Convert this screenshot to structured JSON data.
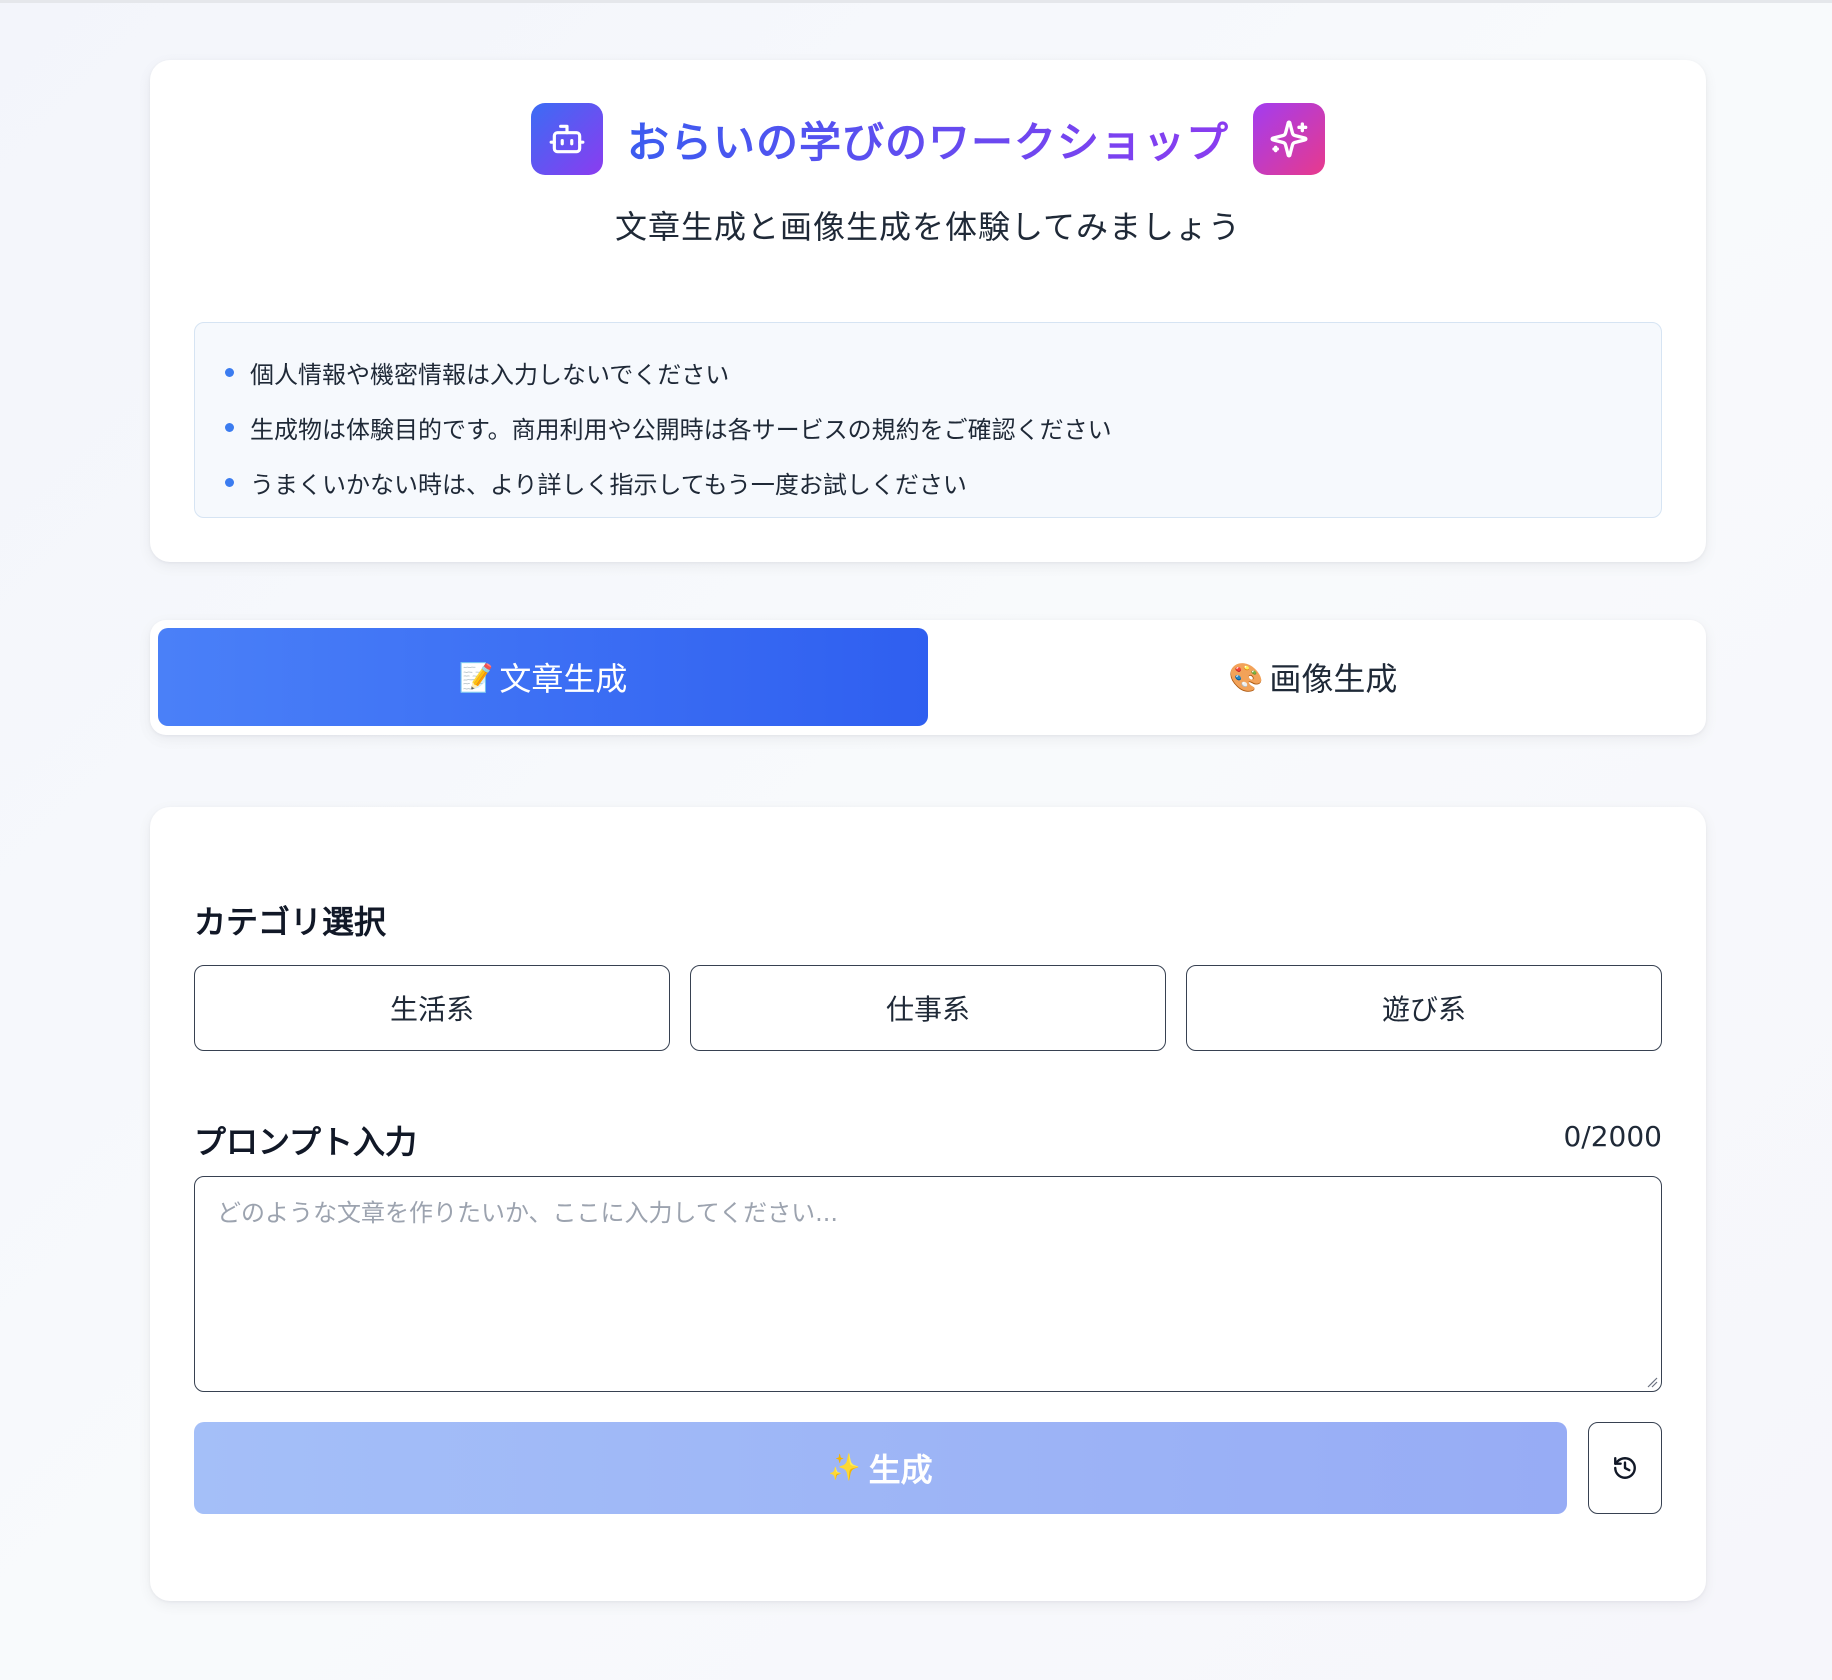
{
  "header": {
    "title": "おらいの学びのワークショップ",
    "subtitle": "文章生成と画像生成を体験してみましょう",
    "left_icon": "robot-icon",
    "right_icon": "sparkles-icon",
    "notices": [
      "個人情報や機密情報は入力しないでください",
      "生成物は体験目的です。商用利用や公開時は各サービスの規約をご確認ください",
      "うまくいかない時は、より詳しく指示してもう一度お試しください"
    ]
  },
  "tabs": [
    {
      "emoji": "📝",
      "label": "文章生成",
      "active": true
    },
    {
      "emoji": "🎨",
      "label": "画像生成",
      "active": false
    }
  ],
  "category": {
    "label": "カテゴリ選択",
    "options": [
      "生活系",
      "仕事系",
      "遊び系"
    ]
  },
  "prompt": {
    "label": "プロンプト入力",
    "counter": "0/2000",
    "value": "",
    "placeholder": "どのような文章を作りたいか、ここに入力してください..."
  },
  "actions": {
    "generate_emoji": "✨",
    "generate_label": "生成",
    "history_icon": "history-icon"
  },
  "colors": {
    "accent": "#3b6cf4",
    "accent_purple": "#8b3cf0",
    "pink": "#e83a8c",
    "bullet": "#3b7cf0",
    "generate_disabled": "#a4bff8"
  }
}
